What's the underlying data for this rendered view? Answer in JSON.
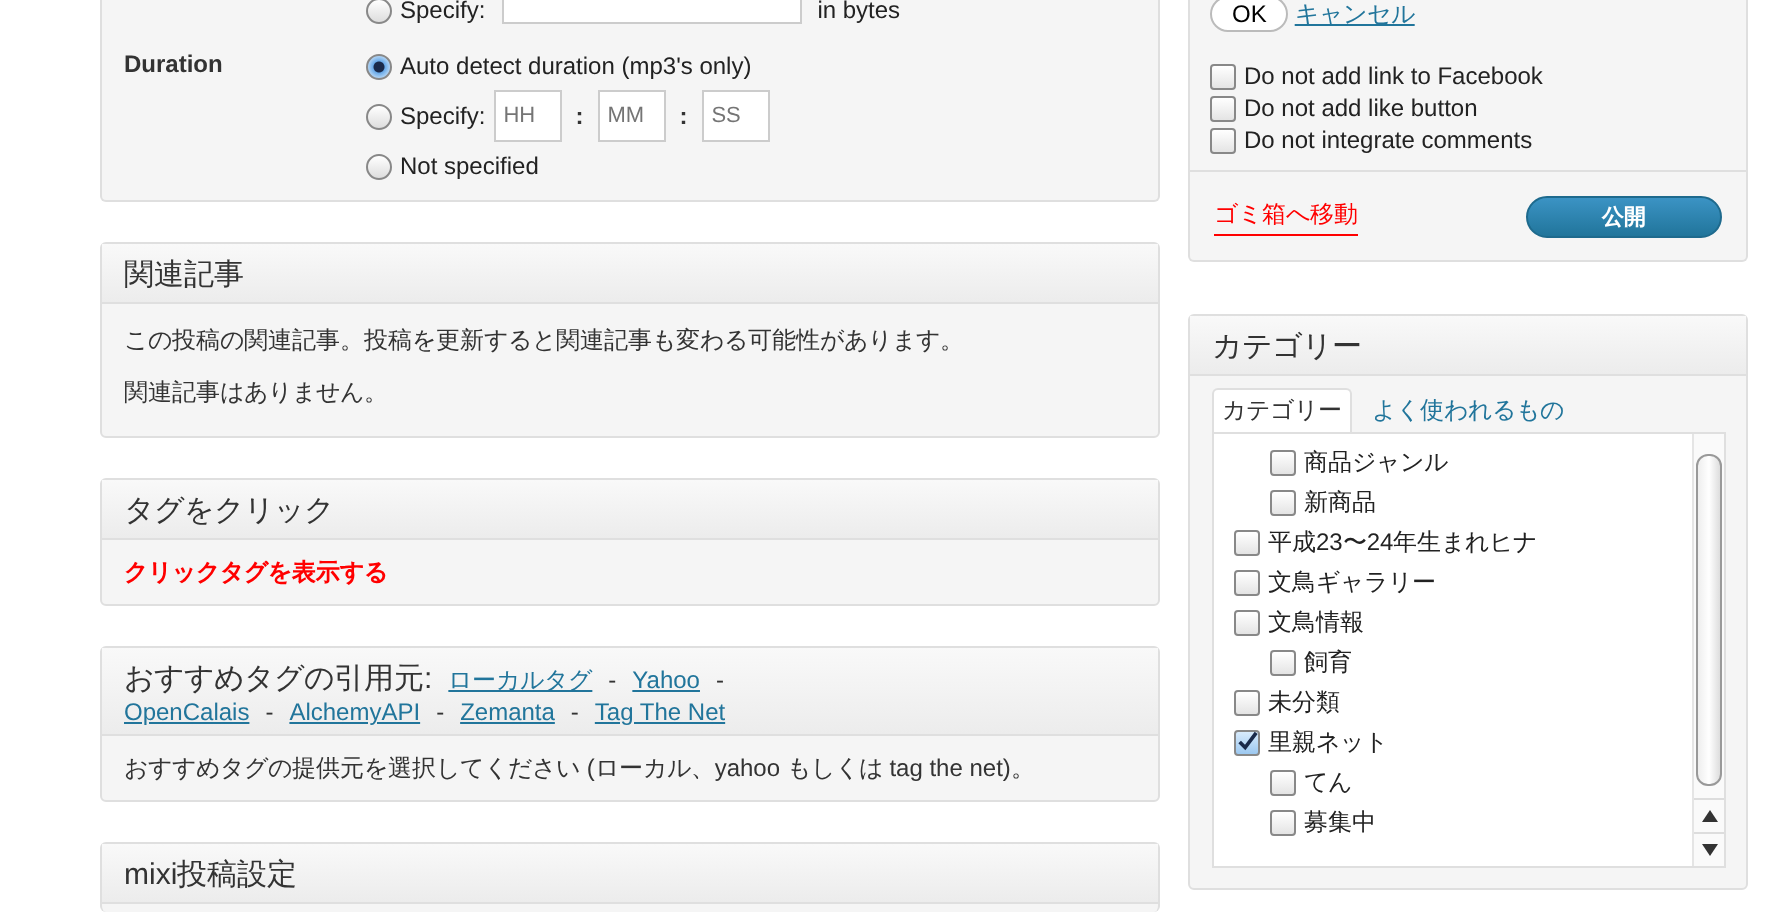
{
  "size_option": {
    "label": "Specify:",
    "selected": false,
    "suffix": "in bytes"
  },
  "duration": {
    "label": "Duration",
    "options": [
      {
        "kind": "plain",
        "label": "Auto detect duration (mp3's only)",
        "selected": true
      },
      {
        "kind": "time",
        "label": "Specify:",
        "selected": false,
        "fields": [
          {
            "placeholder": "HH"
          },
          {
            "placeholder": "MM"
          },
          {
            "placeholder": "SS"
          }
        ],
        "separator": ":"
      },
      {
        "kind": "plain",
        "label": "Not specified",
        "selected": false
      }
    ]
  },
  "related": {
    "title": "関連記事",
    "texts": [
      "この投稿の関連記事。投稿を更新すると関連記事も変わる可能性があります。",
      "関連記事はありません。"
    ]
  },
  "click_tags": {
    "title": "タグをクリック",
    "link": "クリックタグを表示する"
  },
  "suggest": {
    "title": "おすすめタグの引用元:",
    "sources": [
      "ローカルタグ",
      "Yahoo",
      "OpenCalais",
      "AlchemyAPI",
      "Zemanta",
      "Tag The Net"
    ],
    "separator": "-",
    "text": "おすすめタグの提供元を選択してください (ローカル、yahoo もしくは tag the net)。"
  },
  "mixi": {
    "title": "mixi投稿設定"
  },
  "publish": {
    "ok": "OK",
    "cancel": "キャンセル",
    "options": [
      {
        "label": "Do not add link to Facebook",
        "checked": false
      },
      {
        "label": "Do not add like button",
        "checked": false
      },
      {
        "label": "Do not integrate comments",
        "checked": false
      }
    ],
    "trash": "ゴミ箱へ移動",
    "publish": "公開"
  },
  "categories": {
    "title": "カテゴリー",
    "tabs": [
      {
        "label": "カテゴリー",
        "selected": true
      },
      {
        "label": "よく使われるもの",
        "selected": false
      }
    ],
    "items": [
      {
        "children": [
          {
            "label": "商品ジャンル",
            "checked": false
          },
          {
            "label": "新商品",
            "checked": false
          }
        ]
      },
      {
        "label": "平成23〜24年生まれヒナ",
        "checked": false
      },
      {
        "label": "文鳥ギャラリー",
        "checked": false
      },
      {
        "label": "文鳥情報",
        "checked": false,
        "children": [
          {
            "label": "飼育",
            "checked": false
          }
        ]
      },
      {
        "label": "未分類",
        "checked": false
      },
      {
        "label": "里親ネット",
        "checked": true,
        "children": [
          {
            "label": "てん",
            "checked": false
          },
          {
            "label": "募集中",
            "checked": false
          }
        ]
      }
    ]
  }
}
